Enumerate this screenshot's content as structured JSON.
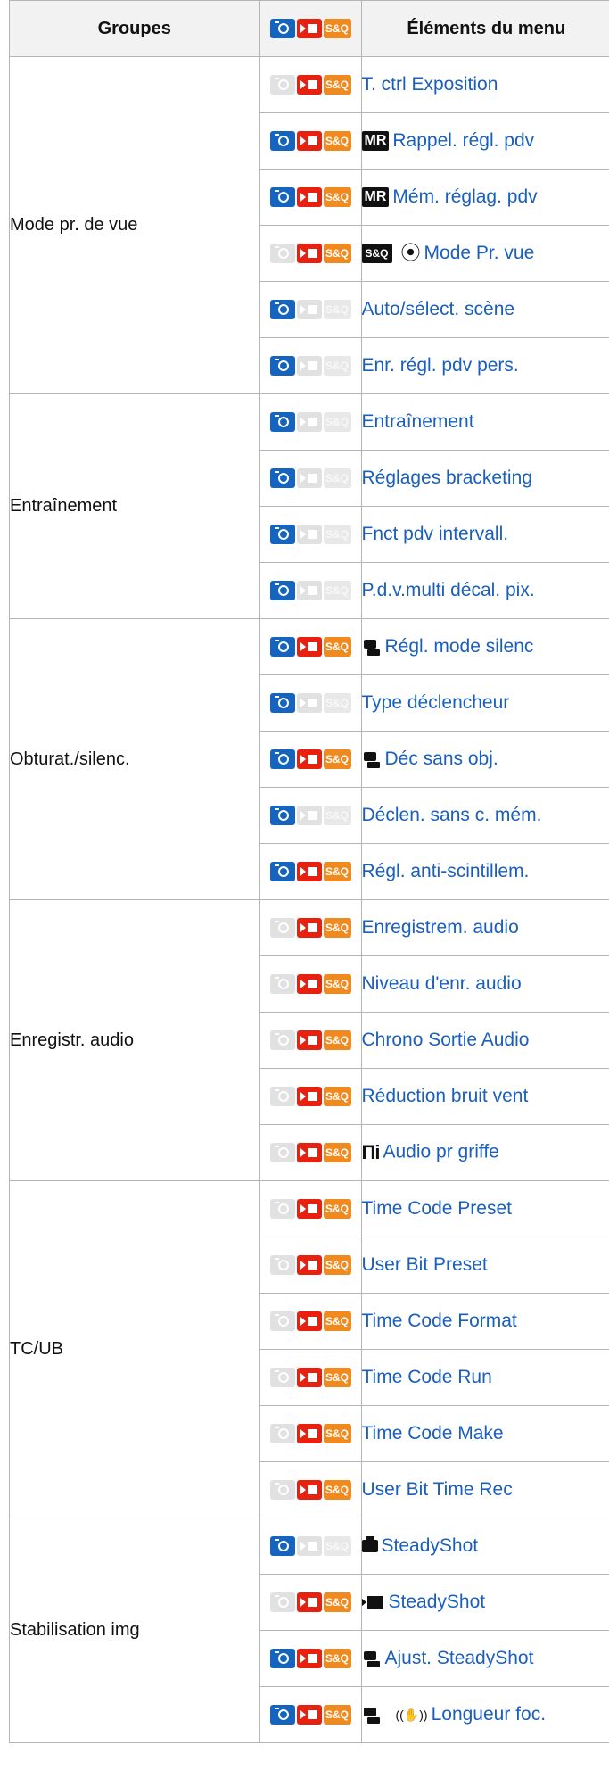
{
  "header": {
    "groups": "Groupes",
    "items": "Éléments du menu",
    "mode_icons": [
      "photo-icon",
      "movie-icon",
      "s-and-q-icon"
    ],
    "sq_label": "S&Q"
  },
  "colors": {
    "photo": "#1565c0",
    "movie": "#e8200f",
    "sq": "#f08a1e",
    "disabled": "#e1e1e1",
    "link": "#1a5fbe"
  },
  "groups": [
    {
      "name": "Mode pr. de vue",
      "rows": [
        {
          "photo": false,
          "movie": true,
          "sq": true,
          "prefix_icons": [],
          "label": "T. ctrl Exposition"
        },
        {
          "photo": true,
          "movie": true,
          "sq": true,
          "prefix_icons": [
            "mr-icon"
          ],
          "prefix_text": "MR",
          "label": "Rappel. régl. pdv"
        },
        {
          "photo": true,
          "movie": true,
          "sq": true,
          "prefix_icons": [
            "mr-icon"
          ],
          "prefix_text": "MR",
          "label": "Mém. réglag. pdv"
        },
        {
          "photo": false,
          "movie": true,
          "sq": true,
          "prefix_icons": [
            "s-and-q-icon",
            "dial-mode-icon"
          ],
          "prefix_text": "S&Q",
          "label": "Mode Pr. vue"
        },
        {
          "photo": true,
          "movie": false,
          "sq": false,
          "prefix_icons": [],
          "label": "Auto/sélect. scène"
        },
        {
          "photo": true,
          "movie": false,
          "sq": false,
          "prefix_icons": [],
          "label": "Enr. régl. pdv pers."
        }
      ]
    },
    {
      "name": "Entraînement",
      "rows": [
        {
          "photo": true,
          "movie": false,
          "sq": false,
          "prefix_icons": [],
          "label": "Entraînement"
        },
        {
          "photo": true,
          "movie": false,
          "sq": false,
          "prefix_icons": [],
          "label": "Réglages bracketing"
        },
        {
          "photo": true,
          "movie": false,
          "sq": false,
          "prefix_icons": [],
          "label": "Fnct pdv intervall."
        },
        {
          "photo": true,
          "movie": false,
          "sq": false,
          "prefix_icons": [],
          "label": "P.d.v.multi décal. pix."
        }
      ]
    },
    {
      "name": "Obturat./silenc.",
      "rows": [
        {
          "photo": true,
          "movie": true,
          "sq": true,
          "prefix_icons": [
            "photo-movie-icon"
          ],
          "label": "Régl. mode silenc"
        },
        {
          "photo": true,
          "movie": false,
          "sq": false,
          "prefix_icons": [],
          "label": "Type déclencheur"
        },
        {
          "photo": true,
          "movie": true,
          "sq": true,
          "prefix_icons": [
            "photo-movie-icon"
          ],
          "label": "Déc sans obj."
        },
        {
          "photo": true,
          "movie": false,
          "sq": false,
          "prefix_icons": [],
          "label": "Déclen. sans c. mém."
        },
        {
          "photo": true,
          "movie": true,
          "sq": true,
          "prefix_icons": [],
          "label": "Régl. anti-scintillem."
        }
      ]
    },
    {
      "name": "Enregistr. audio",
      "rows": [
        {
          "photo": false,
          "movie": true,
          "sq": true,
          "prefix_icons": [],
          "label": "Enregistrem. audio"
        },
        {
          "photo": false,
          "movie": true,
          "sq": true,
          "prefix_icons": [],
          "label": "Niveau d'enr. audio"
        },
        {
          "photo": false,
          "movie": true,
          "sq": true,
          "prefix_icons": [],
          "label": "Chrono Sortie Audio"
        },
        {
          "photo": false,
          "movie": true,
          "sq": true,
          "prefix_icons": [],
          "label": "Réduction bruit vent"
        },
        {
          "photo": false,
          "movie": true,
          "sq": true,
          "prefix_icons": [
            "multi-interface-shoe-icon"
          ],
          "label": "Audio pr griffe"
        }
      ]
    },
    {
      "name": "TC/UB",
      "rows": [
        {
          "photo": false,
          "movie": true,
          "sq": true,
          "prefix_icons": [],
          "label": "Time Code Preset"
        },
        {
          "photo": false,
          "movie": true,
          "sq": true,
          "prefix_icons": [],
          "label": "User Bit Preset"
        },
        {
          "photo": false,
          "movie": true,
          "sq": true,
          "prefix_icons": [],
          "label": "Time Code Format"
        },
        {
          "photo": false,
          "movie": true,
          "sq": true,
          "prefix_icons": [],
          "label": "Time Code Run"
        },
        {
          "photo": false,
          "movie": true,
          "sq": true,
          "prefix_icons": [],
          "label": "Time Code Make"
        },
        {
          "photo": false,
          "movie": true,
          "sq": true,
          "prefix_icons": [],
          "label": "User Bit Time Rec"
        }
      ]
    },
    {
      "name": "Stabilisation img",
      "rows": [
        {
          "photo": true,
          "movie": false,
          "sq": false,
          "prefix_icons": [
            "still-camera-icon"
          ],
          "label": "SteadyShot"
        },
        {
          "photo": false,
          "movie": true,
          "sq": true,
          "prefix_icons": [
            "movie-camera-icon"
          ],
          "label": "SteadyShot"
        },
        {
          "photo": true,
          "movie": true,
          "sq": true,
          "prefix_icons": [
            "photo-movie-icon"
          ],
          "label": "Ajust. SteadyShot"
        },
        {
          "photo": true,
          "movie": true,
          "sq": true,
          "prefix_icons": [
            "photo-movie-icon",
            "steadyshot-hand-icon"
          ],
          "label": "Longueur foc."
        }
      ]
    }
  ]
}
